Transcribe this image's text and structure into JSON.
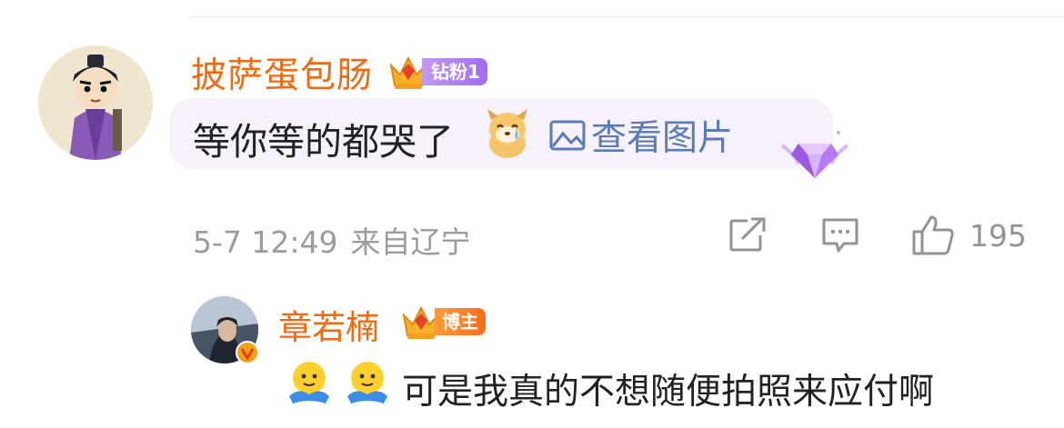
{
  "comment": {
    "author": "披萨蛋包肠",
    "fan_badge": "钻粉1",
    "text": "等你等的都哭了",
    "view_image": "查看图片",
    "time": "5-7 12:49",
    "location": "来自辽宁",
    "like_count": "195"
  },
  "reply": {
    "author": "章若楠",
    "badge": "博主",
    "text": "可是我真的不想随便拍照来应付啊"
  },
  "colors": {
    "name": "#f06a12",
    "link": "#5a7cb6",
    "meta": "#9b9b9b",
    "bubble": "#f7f1fb"
  },
  "icons": [
    "crown-icon",
    "cry-dog-sticker",
    "image-icon",
    "diamond-icon",
    "share-icon",
    "comment-icon",
    "like-icon",
    "verified-icon",
    "hug-emoji"
  ]
}
